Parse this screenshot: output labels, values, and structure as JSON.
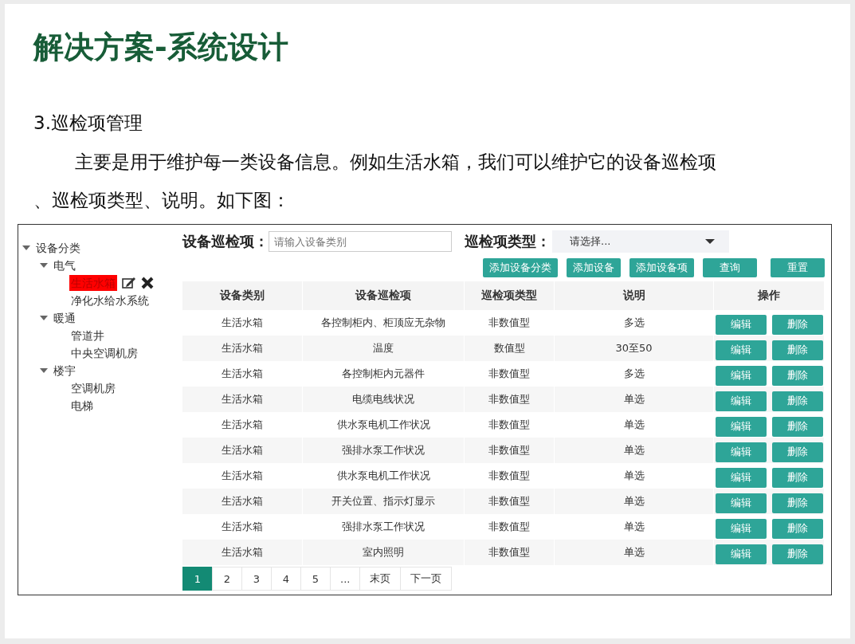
{
  "slide": {
    "title": "解决方案-系统设计",
    "subtitle": "3.巡检项管理",
    "paragraph_lines": [
      "主要是用于维护每一类设备信息。例如生活水箱，我们可以维护它的设备巡检项",
      "、巡检项类型、说明。如下图："
    ]
  },
  "tree": [
    {
      "label": "设备分类",
      "expanded": true,
      "selected": false,
      "children": [
        {
          "label": "电气",
          "expanded": true,
          "selected": false,
          "children": [
            {
              "label": "生活水箱",
              "selected": true
            },
            {
              "label": "净化水给水系统",
              "selected": false
            }
          ]
        },
        {
          "label": "暖通",
          "expanded": true,
          "selected": false,
          "children": [
            {
              "label": "管道井",
              "selected": false
            },
            {
              "label": "中央空调机房",
              "selected": false
            }
          ]
        },
        {
          "label": "楼宇",
          "expanded": true,
          "selected": false,
          "children": [
            {
              "label": "空调机房",
              "selected": false
            },
            {
              "label": "电梯",
              "selected": false
            }
          ]
        }
      ]
    }
  ],
  "filters": {
    "item_label": "设备巡检项：",
    "item_placeholder": "请输入设备类别",
    "type_label": "巡检项类型：",
    "type_value": "请选择..."
  },
  "buttons": [
    "添加设备分类",
    "添加设备",
    "添加设备项",
    "查询",
    "重置"
  ],
  "table": {
    "columns": [
      "设备类别",
      "设备巡检项",
      "巡检项类型",
      "说明",
      "操作"
    ],
    "rows": [
      {
        "cells": [
          "生活水箱",
          "各控制柜内、柜顶应无杂物",
          "非数值型",
          "多选"
        ],
        "actions": [
          "编辑",
          "删除"
        ]
      },
      {
        "cells": [
          "生活水箱",
          "温度",
          "数值型",
          "30至50"
        ],
        "actions": [
          "编辑",
          "删除"
        ]
      },
      {
        "cells": [
          "生活水箱",
          "各控制柜内元器件",
          "非数值型",
          "多选"
        ],
        "actions": [
          "编辑",
          "删除"
        ]
      },
      {
        "cells": [
          "生活水箱",
          "电缆电线状况",
          "非数值型",
          "单选"
        ],
        "actions": [
          "编辑",
          "删除"
        ]
      },
      {
        "cells": [
          "生活水箱",
          "供水泵电机工作状况",
          "非数值型",
          "单选"
        ],
        "actions": [
          "编辑",
          "删除"
        ]
      },
      {
        "cells": [
          "生活水箱",
          "强排水泵工作状况",
          "非数值型",
          "单选"
        ],
        "actions": [
          "编辑",
          "删除"
        ]
      },
      {
        "cells": [
          "生活水箱",
          "供水泵电机工作状况",
          "非数值型",
          "单选"
        ],
        "actions": [
          "编辑",
          "删除"
        ]
      },
      {
        "cells": [
          "生活水箱",
          "开关位置、指示灯显示",
          "非数值型",
          "单选"
        ],
        "actions": [
          "编辑",
          "删除"
        ]
      },
      {
        "cells": [
          "生活水箱",
          "强排水泵工作状况",
          "非数值型",
          "单选"
        ],
        "actions": [
          "编辑",
          "删除"
        ]
      },
      {
        "cells": [
          "生活水箱",
          "室内照明",
          "非数值型",
          "单选"
        ],
        "actions": [
          "编辑",
          "删除"
        ]
      }
    ]
  },
  "pagination": [
    {
      "label": "1",
      "selected": true
    },
    {
      "label": "2",
      "selected": false
    },
    {
      "label": "3",
      "selected": false
    },
    {
      "label": "4",
      "selected": false
    },
    {
      "label": "5",
      "selected": false
    },
    {
      "label": "...",
      "selected": false
    },
    {
      "label": "末页",
      "selected": false
    },
    {
      "label": "下一页",
      "selected": false
    }
  ]
}
